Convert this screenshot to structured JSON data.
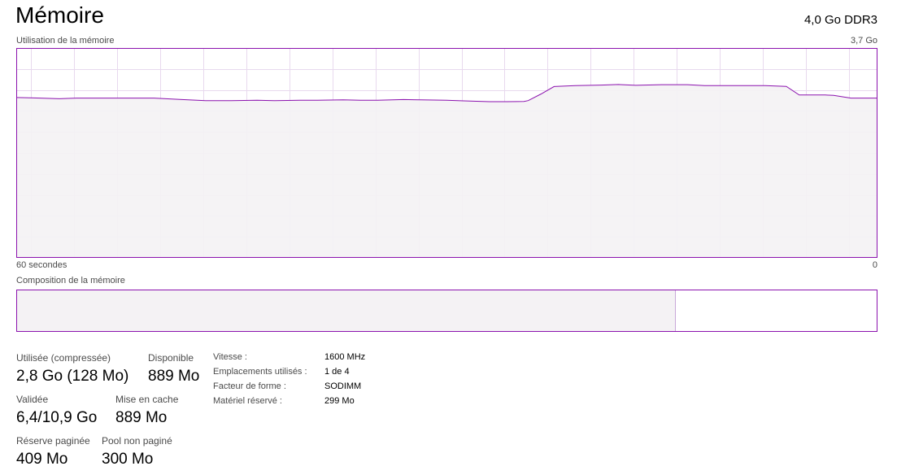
{
  "header": {
    "title": "Mémoire",
    "spec": "4,0 Go DDR3"
  },
  "usage_chart": {
    "label": "Utilisation de la mémoire",
    "max_label": "3,7 Go",
    "time_start_label": "60 secondes",
    "time_end_label": "0",
    "line_color": "#8b12ae",
    "fill_color": "#f4f2f4"
  },
  "composition": {
    "label": "Composition de la mémoire",
    "in_use_fraction": 0.765
  },
  "stats": {
    "used_label": "Utilisée (compressée)",
    "used_value": "2,8 Go (128 Mo)",
    "available_label": "Disponible",
    "available_value": "889 Mo",
    "committed_label": "Validée",
    "committed_value": "6,4/10,9 Go",
    "cached_label": "Mise en cache",
    "cached_value": "889 Mo",
    "paged_label": "Réserve paginée",
    "paged_value": "409 Mo",
    "nonpaged_label": "Pool non paginé",
    "nonpaged_value": "300 Mo"
  },
  "details": {
    "speed_label": "Vitesse :",
    "speed_value": "1600 MHz",
    "slots_label": "Emplacements utilisés :",
    "slots_value": "1 de 4",
    "form_label": "Facteur de forme :",
    "form_value": "SODIMM",
    "reserved_label": "Matériel réservé :",
    "reserved_value": "299 Mo"
  }
}
